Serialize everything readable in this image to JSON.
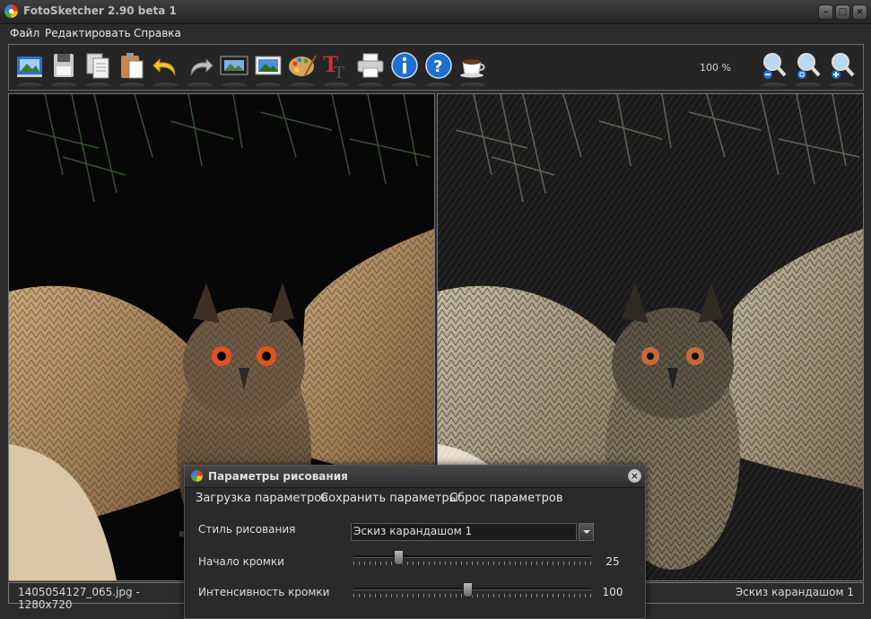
{
  "window": {
    "title": "FotoSketcher 2.90 beta 1",
    "controls": [
      "minimize",
      "maximize",
      "close"
    ]
  },
  "menu": {
    "file": "Файл",
    "edit": "Редактировать",
    "help": "Справка"
  },
  "toolbar": {
    "buttons": [
      {
        "icon": "open-image-icon"
      },
      {
        "icon": "save-disk-icon"
      },
      {
        "icon": "copy-icon"
      },
      {
        "icon": "paste-icon"
      },
      {
        "icon": "undo-arrow-icon"
      },
      {
        "icon": "redo-arrow-icon"
      },
      {
        "icon": "film-frame-icon"
      },
      {
        "icon": "landscape-picture-icon"
      },
      {
        "icon": "palette-icon"
      },
      {
        "icon": "text-tool-icon"
      },
      {
        "icon": "printer-icon"
      },
      {
        "icon": "info-icon"
      },
      {
        "icon": "help-question-icon"
      },
      {
        "icon": "coffee-cup-icon"
      }
    ],
    "zoom_level": "100 %",
    "zoom_buttons": [
      "zoom-out-icon",
      "zoom-fit-icon",
      "zoom-in-icon"
    ]
  },
  "status": {
    "left": "1405054127_065.jpg - 1280x720",
    "right": "Эскиз карандашом 1"
  },
  "dialog": {
    "title": "Параметры рисования",
    "menu": {
      "load": "Загрузка параметров",
      "save": "Сохранить параметры",
      "reset": "Сброс параметров"
    },
    "style_label": "Стиль рисования",
    "style_value": "Эскиз карандашом 1",
    "edge_start_label": "Начало кромки",
    "edge_start_value": "25",
    "edge_start_fraction": 0.1,
    "edge_intensity_label": "Интенсивность кромки",
    "edge_intensity_value": "100",
    "edge_intensity_fraction": 0.4
  },
  "colors": {
    "background": "#2b2b2b",
    "border": "#777777",
    "text": "#dddddd"
  }
}
